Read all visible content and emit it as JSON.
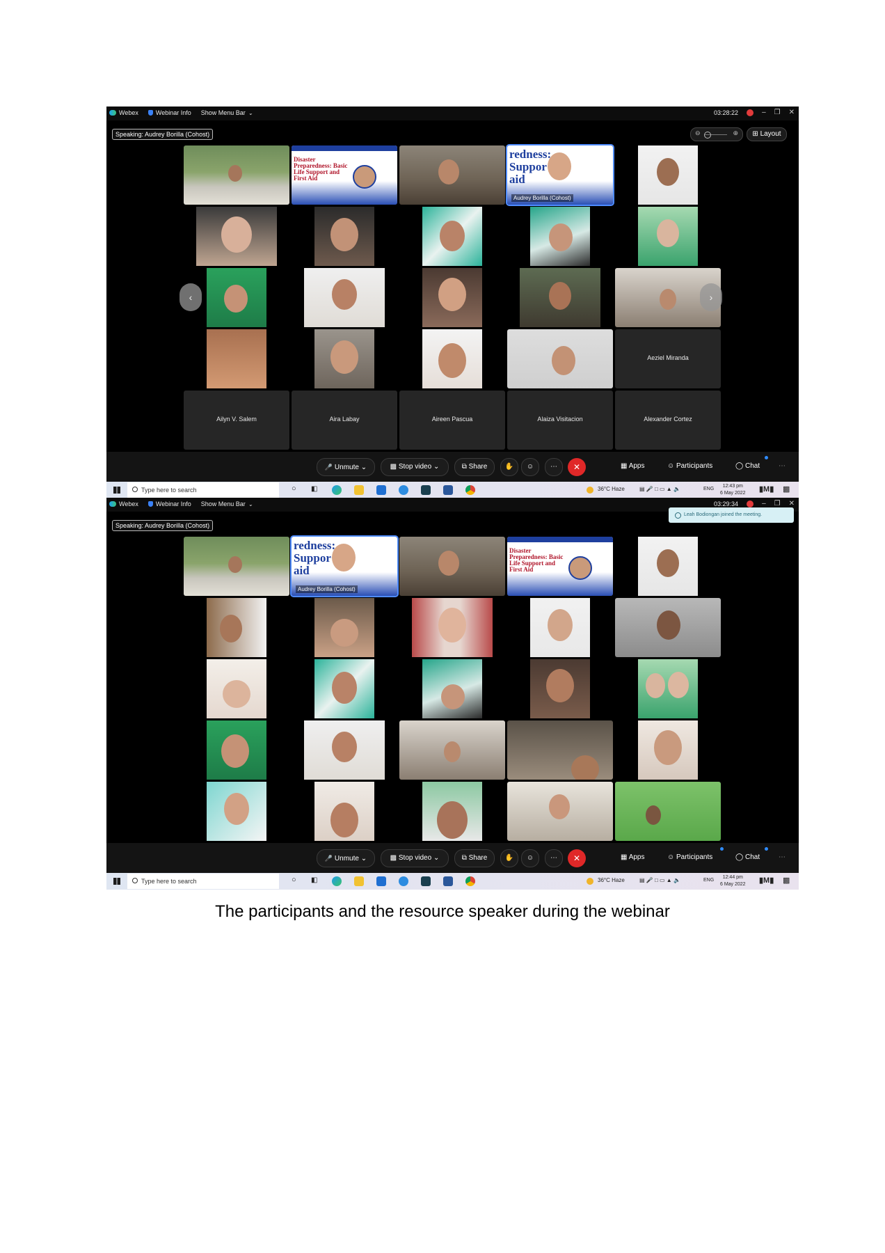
{
  "screens": [
    {
      "topbar": {
        "app_name": "Webex",
        "webinar_info": "Webinar Info",
        "show_menu_bar": "Show Menu Bar",
        "timer": "03:28:22"
      },
      "speaking": "Speaking: Audrey Borilla (Cohost)",
      "layout_label": "Layout",
      "speaker_label": "Audrey Borilla (Cohost)",
      "name_tiles": [
        "Aeziel Miranda",
        "Ailyn V. Salem",
        "Aira Labay",
        "Aireen Pascua",
        "Alaiza Visitacion",
        "Alexander Cortez"
      ],
      "slide_small": "Disaster Preparedness: Basic Life Support and First Aid",
      "slide_big": "redness: Suppor aid",
      "controls": {
        "unmute": "Unmute",
        "stop_video": "Stop video",
        "share": "Share",
        "apps": "Apps",
        "participants": "Participants",
        "chat": "Chat"
      },
      "taskbar": {
        "search_placeholder": "Type here to search",
        "weather": "36°C  Haze",
        "lang": "ENG",
        "time": "12:43 pm",
        "date": "6 May 2022"
      }
    },
    {
      "topbar": {
        "app_name": "Webex",
        "webinar_info": "Webinar Info",
        "show_menu_bar": "Show Menu Bar",
        "timer": "03:29:34"
      },
      "speaking": "Speaking: Audrey Borilla (Cohost)",
      "toast": "Leah Bodiongan joined the meeting.",
      "speaker_label": "Audrey Borilla (Cohost)",
      "slide_small": "Disaster Preparedness: Basic Life Support and First Aid",
      "slide_big": "redness: Suppor aid",
      "controls": {
        "unmute": "Unmute",
        "stop_video": "Stop video",
        "share": "Share",
        "apps": "Apps",
        "participants": "Participants",
        "chat": "Chat"
      },
      "taskbar": {
        "search_placeholder": "Type here to search",
        "weather": "36°C  Haze",
        "lang": "ENG",
        "time": "12:44 pm",
        "date": "6 May 2022"
      }
    }
  ],
  "caption": "The participants and the resource speaker during the webinar",
  "colors": {
    "leave_red": "#e02828",
    "speaker_outline": "#4f8cff",
    "toast_bg": "#d7f0f5"
  }
}
